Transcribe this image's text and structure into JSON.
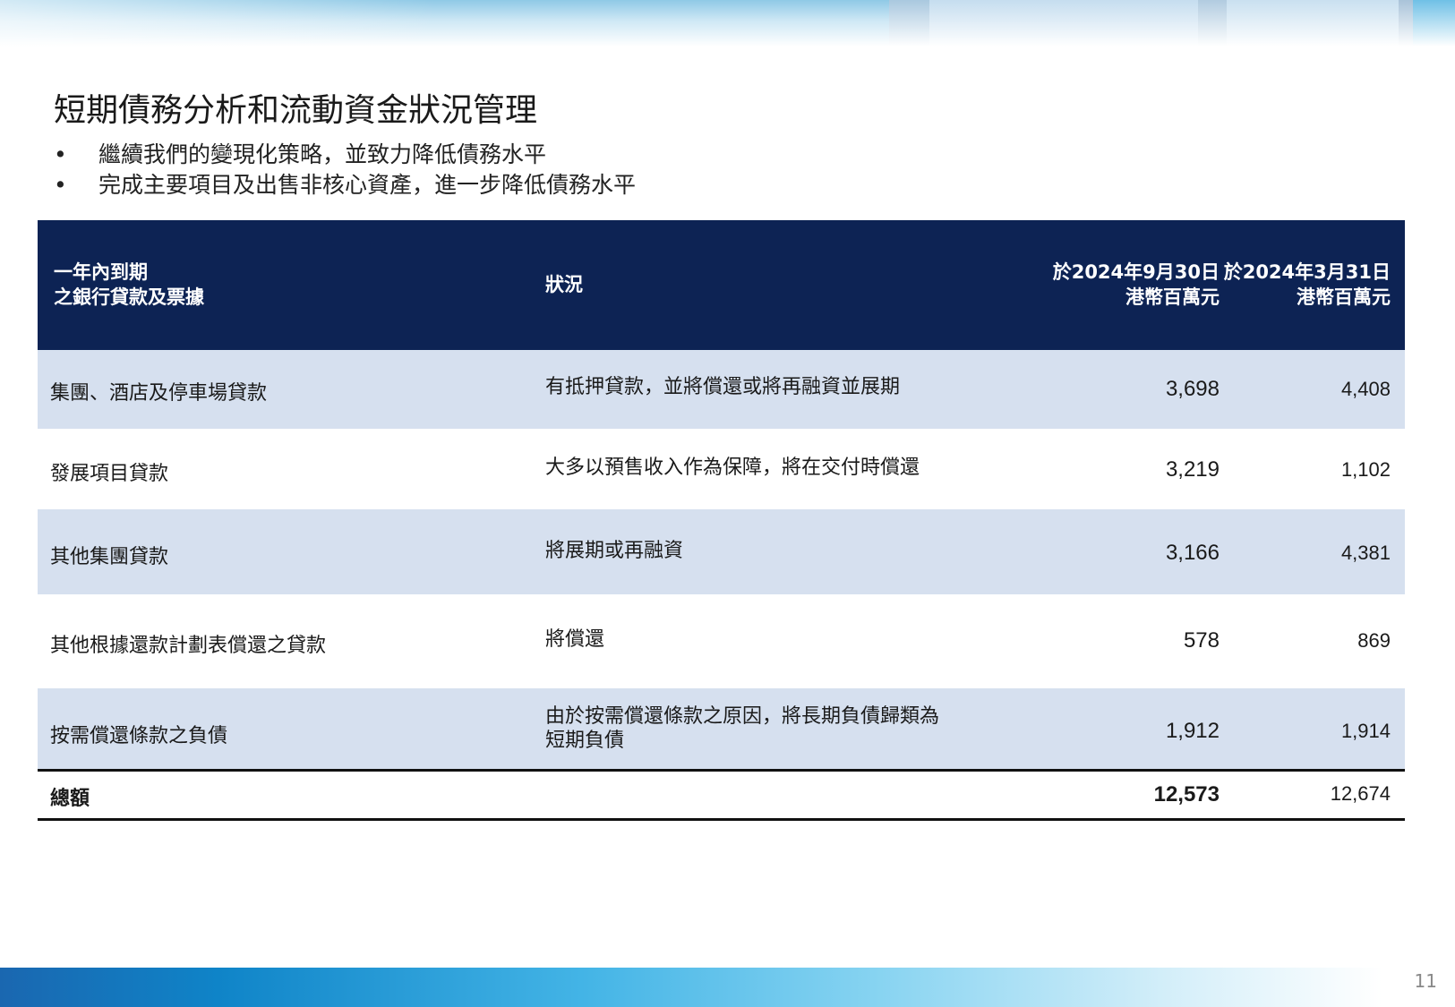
{
  "slide": {
    "title": "短期債務分析和流動資金狀況管理",
    "bullets": [
      "繼續我們的變現化策略，並致力降低債務水平",
      "完成主要項目及出售非核心資產，進一步降低債務水平"
    ],
    "bullet_glyph": "•",
    "page_number": "11"
  },
  "table": {
    "headers": {
      "col1": [
        "一年內到期",
        "之銀行貸款及票據"
      ],
      "col2": "狀況",
      "col3": [
        "於2024年9月30日",
        "港幣百萬元"
      ],
      "col4": [
        "於2024年3月31日",
        "港幣百萬元"
      ]
    },
    "rows": [
      {
        "item": "集團、酒店及停車場貸款",
        "status": [
          "有抵押貸款，並將償還或將再融資並展期"
        ],
        "sep2024": "3,698",
        "mar2024": "4,408"
      },
      {
        "item": "發展項目貸款",
        "status": [
          "大多以預售收入作為保障，將在交付時償還"
        ],
        "sep2024": "3,219",
        "mar2024": "1,102"
      },
      {
        "item": "其他集團貸款",
        "status": [
          "將展期或再融資"
        ],
        "sep2024": "3,166",
        "mar2024": "4,381"
      },
      {
        "item": "其他根據還款計劃表償還之貸款",
        "status": [
          "將償還"
        ],
        "sep2024": "578",
        "mar2024": "869"
      },
      {
        "item": "按需償還條款之負債",
        "status": [
          "由於按需償還條款之原因，將長期負債歸類為",
          "短期負債"
        ],
        "sep2024": "1,912",
        "mar2024": "1,914"
      }
    ],
    "total": {
      "label": "總額",
      "sep2024": "12,573",
      "mar2024": "12,674"
    }
  },
  "colors": {
    "header_bg": "#0d2354",
    "row_shade": "#d6e0ef",
    "accent_blue": "#0f84c8"
  }
}
